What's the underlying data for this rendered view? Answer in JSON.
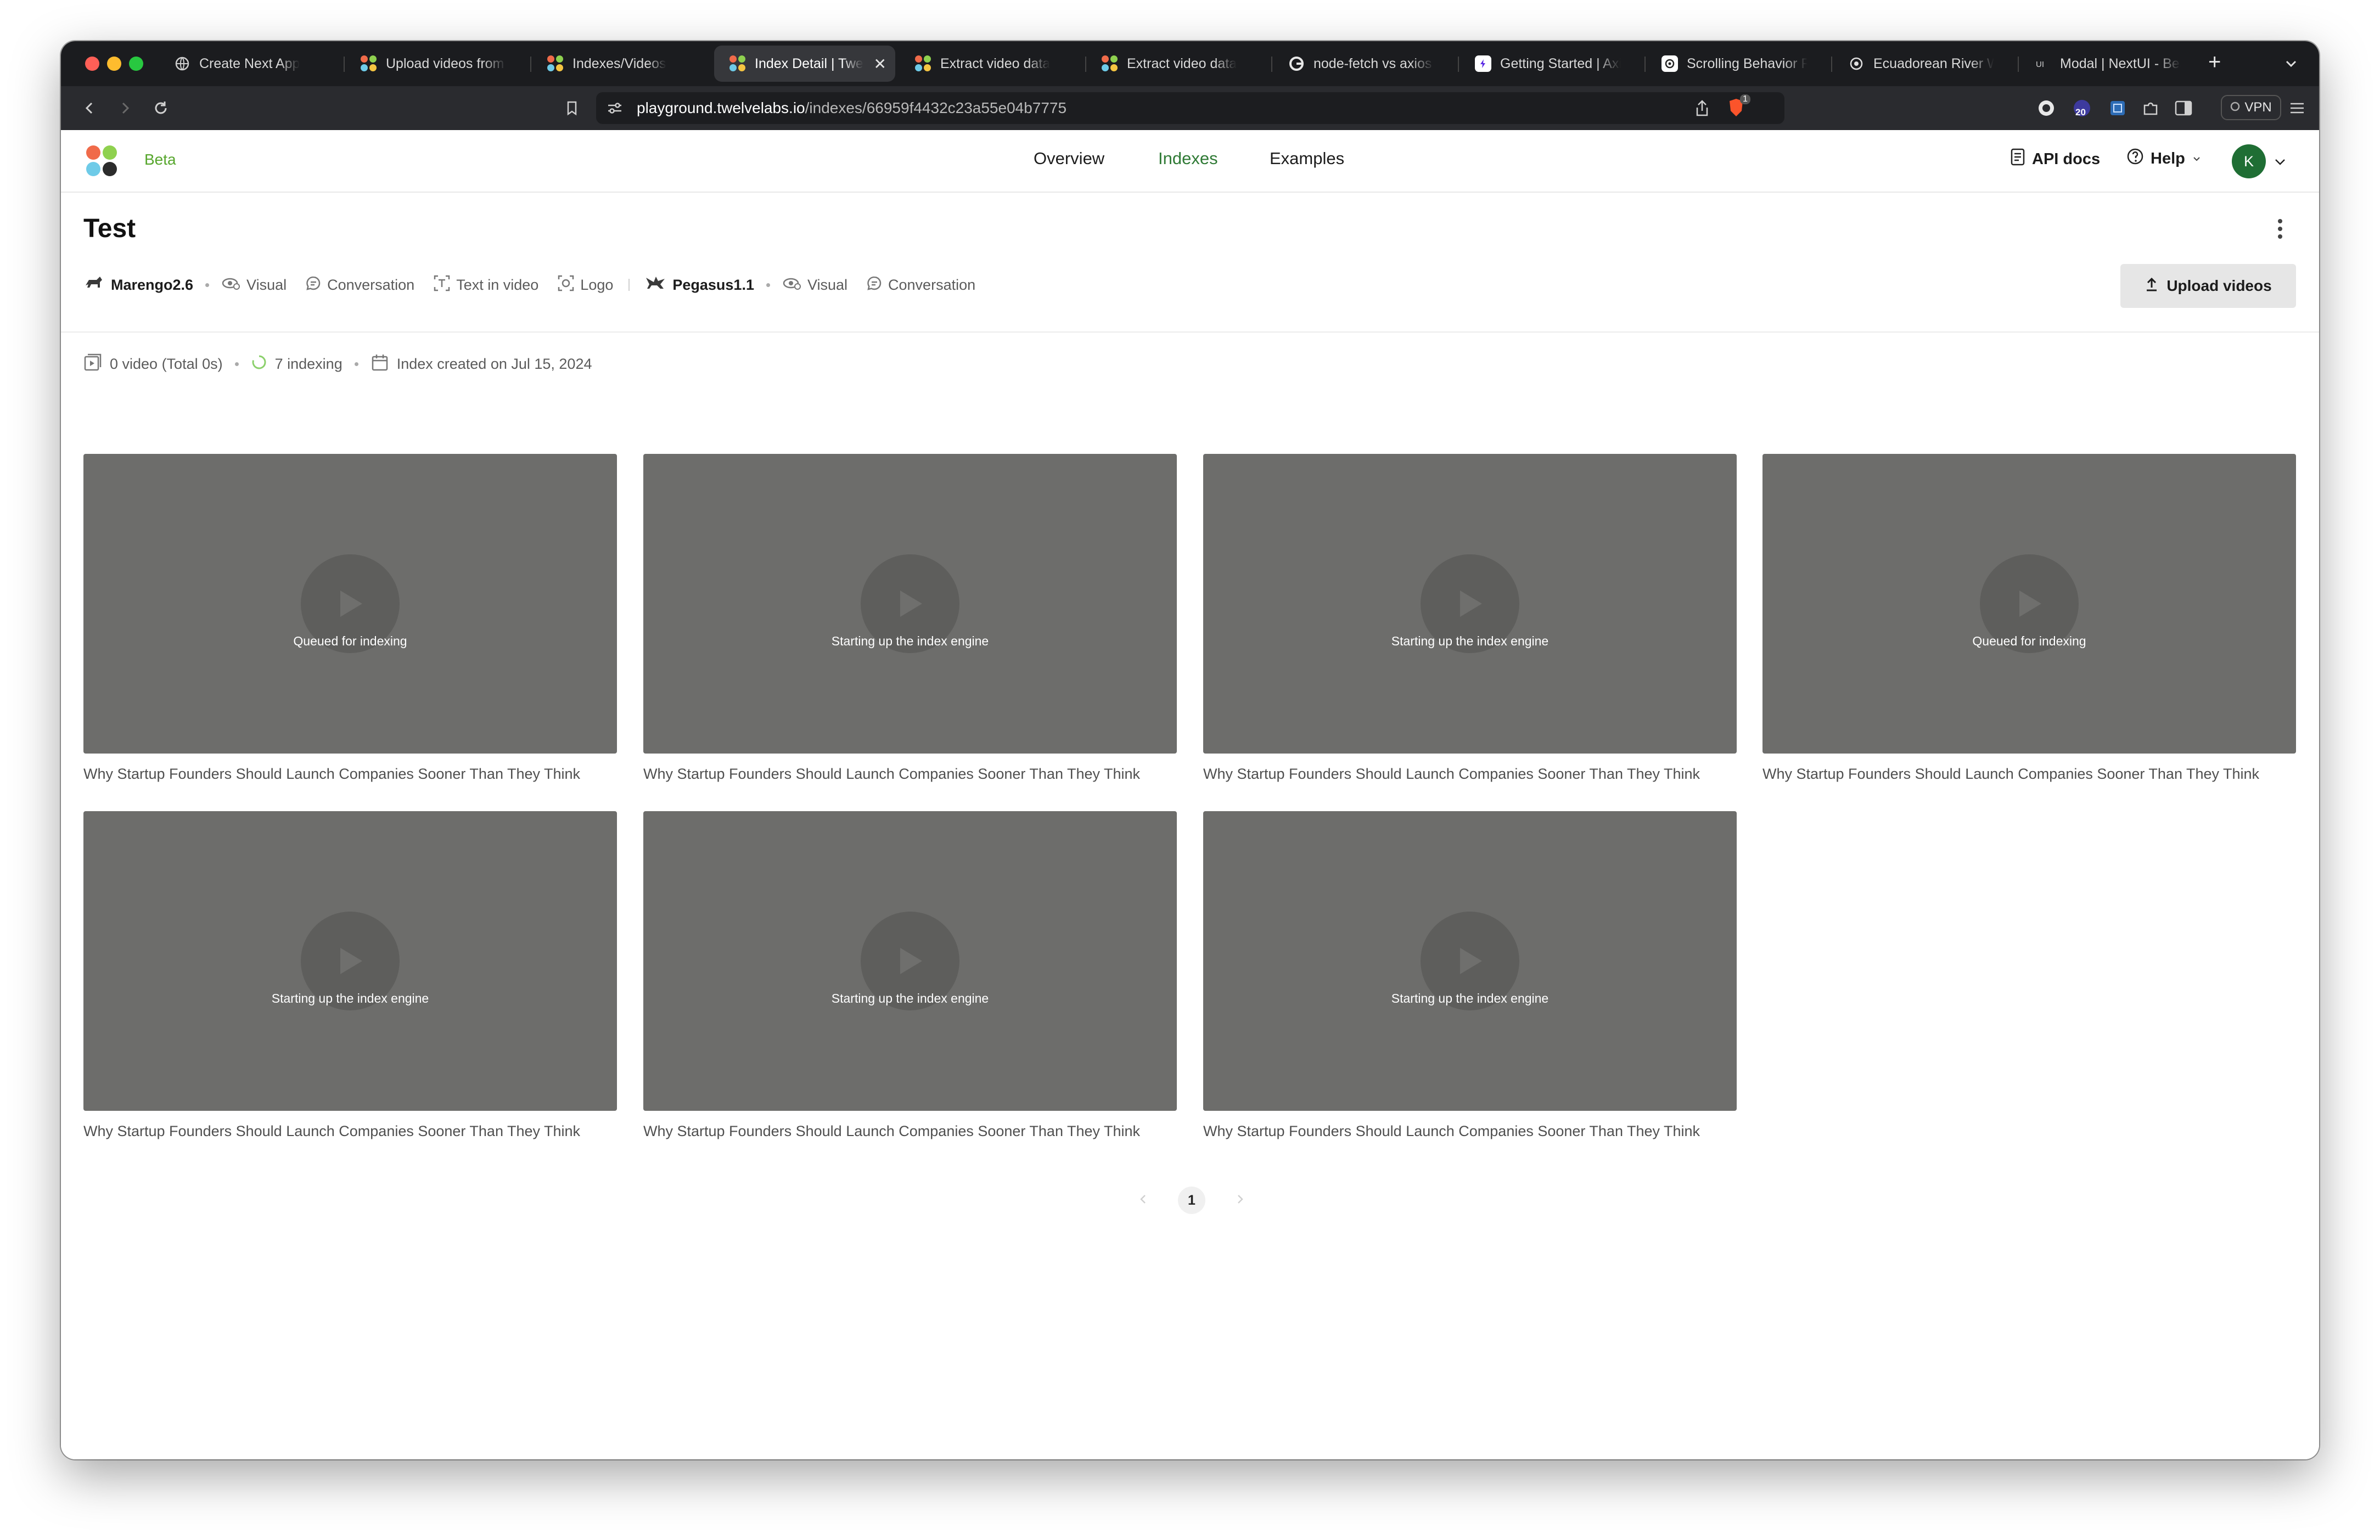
{
  "browser": {
    "tabs": [
      {
        "label": "Create Next App",
        "favicon": "globe-icon"
      },
      {
        "label": "Upload videos from e",
        "favicon": "twelvelabs-icon"
      },
      {
        "label": "Indexes/Videos",
        "favicon": "twelvelabs-icon"
      },
      {
        "label": "Index Detail | Twe",
        "favicon": "twelvelabs-icon",
        "active": true
      },
      {
        "label": "Extract video data",
        "favicon": "twelvelabs-icon"
      },
      {
        "label": "Extract video data",
        "favicon": "twelvelabs-icon"
      },
      {
        "label": "node-fetch vs axios v",
        "favicon": "google-icon"
      },
      {
        "label": "Getting Started | Axio",
        "favicon": "axios-icon"
      },
      {
        "label": "Scrolling Behavior Rig",
        "favicon": "openai-icon"
      },
      {
        "label": "Ecuadorean River Wir",
        "favicon": "wired-icon"
      },
      {
        "label": "Modal | NextUI - Beau",
        "favicon": "nextui-icon"
      }
    ],
    "url_host": "playground.twelvelabs.io",
    "url_path": "/indexes/66959f4432c23a55e04b7775",
    "extension_badge": "20",
    "brave_badge": "1",
    "vpn_label": "VPN"
  },
  "header": {
    "beta_label": "Beta",
    "nav": [
      "Overview",
      "Indexes",
      "Examples"
    ],
    "active_nav": "Indexes",
    "api_docs_label": "API docs",
    "help_label": "Help",
    "avatar_initial": "K"
  },
  "page": {
    "title": "Test",
    "models": {
      "marengo": {
        "name": "Marengo2.6",
        "options": [
          "Visual",
          "Conversation",
          "Text in video",
          "Logo"
        ]
      },
      "pegasus": {
        "name": "Pegasus1.1",
        "options": [
          "Visual",
          "Conversation"
        ]
      }
    },
    "upload_label": "Upload videos",
    "stats": {
      "videos": "0 video (Total 0s)",
      "indexing": "7 indexing",
      "created": "Index created on Jul 15, 2024"
    }
  },
  "videos": [
    {
      "status": "Queued for indexing",
      "title": "Why Startup Founders Should Launch Companies Sooner Than They Think"
    },
    {
      "status": "Starting up the index engine",
      "title": "Why Startup Founders Should Launch Companies Sooner Than They Think"
    },
    {
      "status": "Starting up the index engine",
      "title": "Why Startup Founders Should Launch Companies Sooner Than They Think"
    },
    {
      "status": "Queued for indexing",
      "title": "Why Startup Founders Should Launch Companies Sooner Than They Think"
    },
    {
      "status": "Starting up the index engine",
      "title": "Why Startup Founders Should Launch Companies Sooner Than They Think"
    },
    {
      "status": "Starting up the index engine",
      "title": "Why Startup Founders Should Launch Companies Sooner Than They Think"
    },
    {
      "status": "Starting up the index engine",
      "title": "Why Startup Founders Should Launch Companies Sooner Than They Think"
    }
  ],
  "pagination": {
    "current": "1"
  },
  "colors": {
    "accent_green": "#2f7a35",
    "beta_green": "#56a62c",
    "thumbnail_gray": "#6d6d6b",
    "chrome_dark": "#1b1c1f"
  }
}
